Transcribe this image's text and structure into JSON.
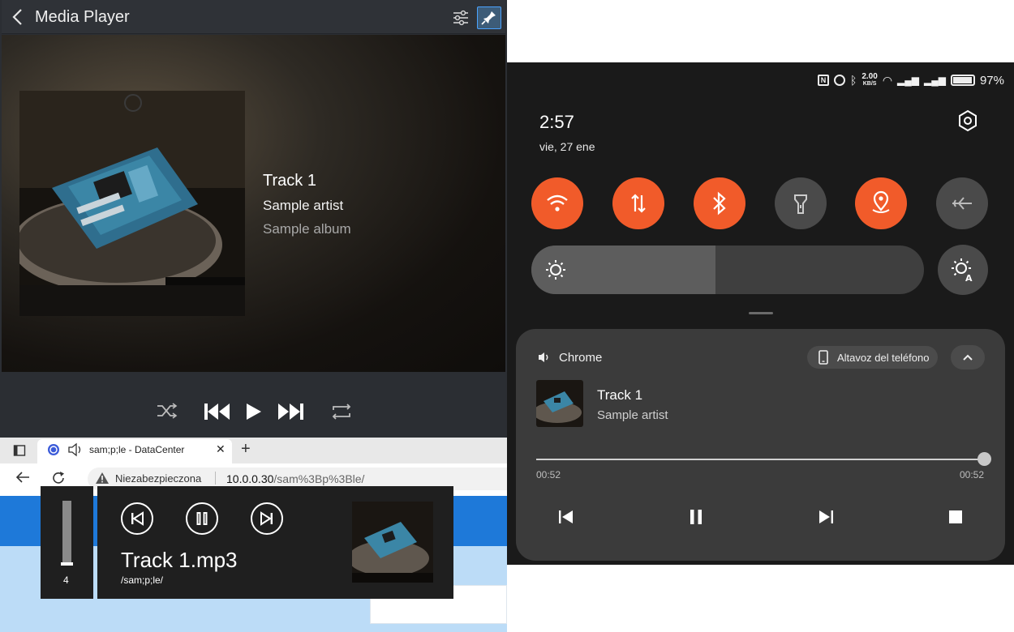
{
  "media_player": {
    "title": "Media Player",
    "track": "Track 1",
    "artist": "Sample artist",
    "album": "Sample album"
  },
  "browser": {
    "tab_title": "sam;p;le - DataCenter",
    "tab_close": "✕",
    "new_tab": "+",
    "security_label": "Niezabezpieczona",
    "url_host": "10.0.0.30",
    "url_path": "/sam%3Bp%3Ble/"
  },
  "flyout": {
    "volume": "4",
    "volume_level": 0.05,
    "track": "Track 1.mp3",
    "path": "/sam;p;le/"
  },
  "quick_settings": {
    "status_text": "97%",
    "net_speed": "2.00",
    "net_unit": "KB/S",
    "time": "2:57",
    "date": "vie, 27 ene",
    "brightness_level": 0.47,
    "tiles": [
      {
        "icon": "wifi-icon",
        "on": true
      },
      {
        "icon": "mobile-data-icon",
        "on": true
      },
      {
        "icon": "bluetooth-icon",
        "on": true
      },
      {
        "icon": "flashlight-icon",
        "on": false
      },
      {
        "icon": "location-icon",
        "on": true
      },
      {
        "icon": "airplane-icon",
        "on": false
      }
    ],
    "accent_color": "#f15b2a"
  },
  "media_card": {
    "app": "Chrome",
    "output": "Altavoz del teléfono",
    "track": "Track 1",
    "artist": "Sample artist",
    "position": "00:52",
    "duration": "00:52",
    "progress": 1.0
  }
}
